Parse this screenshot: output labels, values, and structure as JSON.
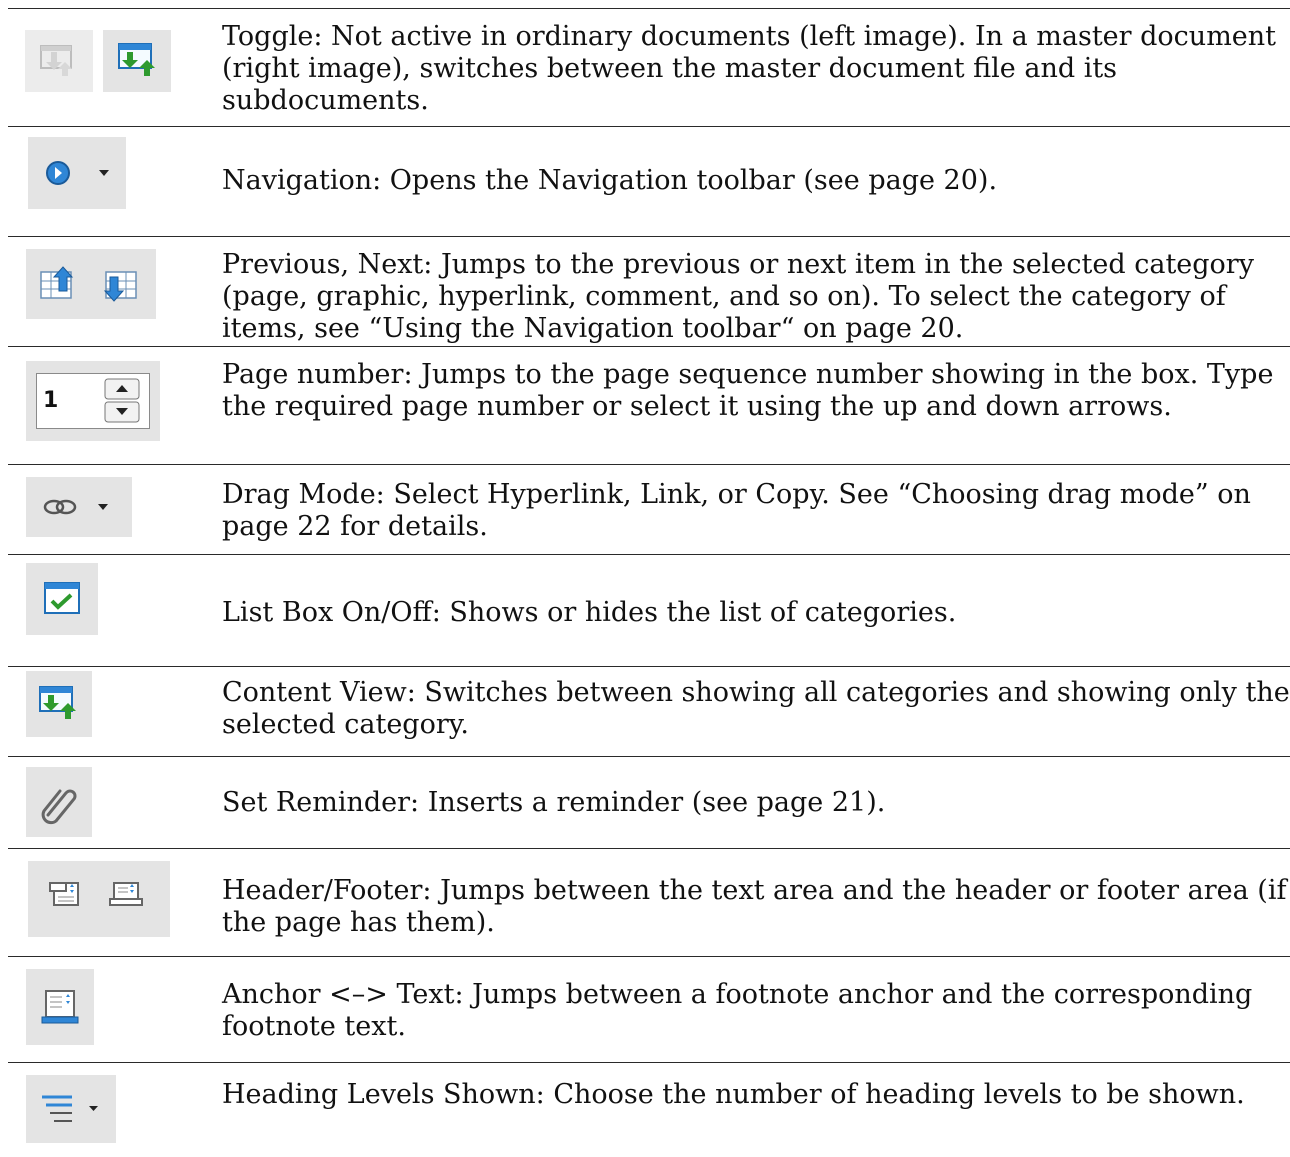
{
  "rows": [
    {
      "text": "Toggle: Not active in ordinary documents (left image). In a master document (right image), switches between the master document file and its subdocuments.",
      "icons": [
        "toggle-master-document-disabled-icon",
        "toggle-master-document-icon"
      ]
    },
    {
      "text": "Navigation: Opens the Navigation toolbar (see page 20).",
      "icons": [
        "navigation-icon",
        "dropdown-arrow-icon"
      ]
    },
    {
      "text": "Previous, Next: Jumps to the previous or next item in the selected category (page, graphic, hyperlink, comment, and so on). To select the category of items, see “Using the Navigation toolbar“ on page 20.",
      "icons": [
        "previous-item-icon",
        "next-item-icon"
      ]
    },
    {
      "text": "Page number: Jumps to the page sequence number showing in the box. Type the required page number or select it using the up and down arrows.",
      "page_value": "1",
      "icons": [
        "spin-up-icon",
        "spin-down-icon"
      ]
    },
    {
      "text": "Drag Mode: Select Hyperlink, Link, or Copy. See “Choosing drag mode” on page 22 for details.",
      "icons": [
        "drag-mode-link-icon",
        "dropdown-arrow-icon"
      ]
    },
    {
      "text": "List Box On/Off: Shows or hides the list of categories.",
      "icons": [
        "list-box-check-icon"
      ]
    },
    {
      "text": "Content View: Switches between showing all categories and showing only the selected category.",
      "icons": [
        "content-view-icon"
      ]
    },
    {
      "text": "Set Reminder: Inserts a reminder (see page 21).",
      "icons": [
        "paperclip-icon"
      ]
    },
    {
      "text": "Header/Footer: Jumps between the text area and the header or footer area (if the page has them).",
      "icons": [
        "header-icon",
        "footer-icon"
      ]
    },
    {
      "text": "Anchor <–> Text: Jumps between a footnote anchor and the corresponding footnote text.",
      "icons": [
        "footnote-anchor-icon"
      ]
    },
    {
      "text": "Heading Levels Shown: Choose the number of heading levels to be shown.",
      "icons": [
        "heading-levels-icon",
        "dropdown-arrow-icon"
      ]
    }
  ],
  "colors": {
    "accent_blue": "#2f86d6",
    "accent_green": "#2e9a2e",
    "tile_gray": "#e4e4e4",
    "rule": "#2a2a2a"
  }
}
